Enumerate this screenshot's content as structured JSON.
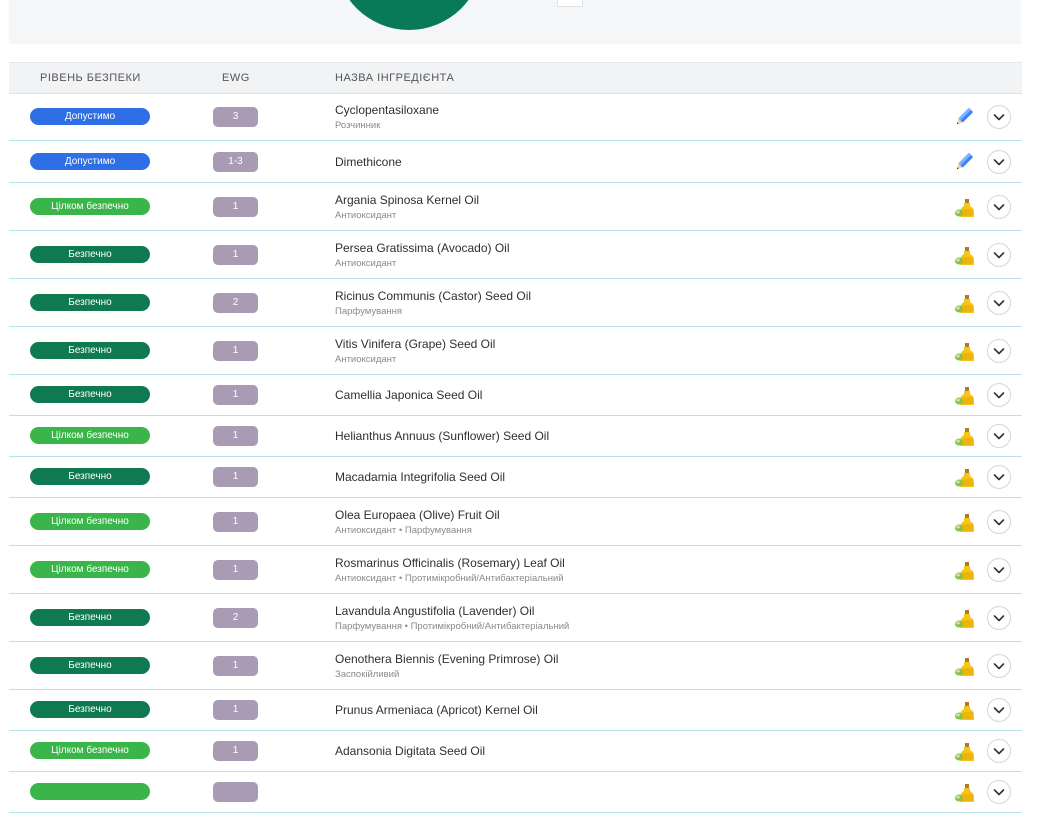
{
  "header": {
    "safety": "РІВЕНЬ БЕЗПЕКИ",
    "ewg": "EWG",
    "name": "НАЗВА ІНГРЕДІЄНТА"
  },
  "colors": {
    "acceptable": "#2f6fe6",
    "completely_safe": "#3ab54a",
    "safe": "#0f7a52",
    "ewg": "#a89bb3"
  },
  "rows": [
    {
      "safety": "Допустимо",
      "level": "acceptable",
      "ewg": "3",
      "name": "Cyclopentasiloxane",
      "func": "Розчинник",
      "icon": "pencil-icon"
    },
    {
      "safety": "Допустимо",
      "level": "acceptable",
      "ewg": "1-3",
      "name": "Dimethicone",
      "func": "",
      "icon": "pencil-icon"
    },
    {
      "safety": "Цілком безпечно",
      "level": "completely_safe",
      "ewg": "1",
      "name": "Argania Spinosa Kernel Oil",
      "func": "Антиоксидант",
      "icon": "oil-bottle-icon"
    },
    {
      "safety": "Безпечно",
      "level": "safe",
      "ewg": "1",
      "name": "Persea Gratissima (Avocado) Oil",
      "func": "Антиоксидант",
      "icon": "oil-bottle-icon"
    },
    {
      "safety": "Безпечно",
      "level": "safe",
      "ewg": "2",
      "name": "Ricinus Communis (Castor) Seed Oil",
      "func": "Парфумування",
      "icon": "oil-bottle-icon"
    },
    {
      "safety": "Безпечно",
      "level": "safe",
      "ewg": "1",
      "name": "Vitis Vinifera (Grape) Seed Oil",
      "func": "Антиоксидант",
      "icon": "oil-bottle-icon"
    },
    {
      "safety": "Безпечно",
      "level": "safe",
      "ewg": "1",
      "name": "Camellia Japonica Seed Oil",
      "func": "",
      "icon": "oil-bottle-icon"
    },
    {
      "safety": "Цілком безпечно",
      "level": "completely_safe",
      "ewg": "1",
      "name": "Helianthus Annuus (Sunflower) Seed Oil",
      "func": "",
      "icon": "oil-bottle-icon"
    },
    {
      "safety": "Безпечно",
      "level": "safe",
      "ewg": "1",
      "name": "Macadamia Integrifolia Seed Oil",
      "func": "",
      "icon": "oil-bottle-icon"
    },
    {
      "safety": "Цілком безпечно",
      "level": "completely_safe",
      "ewg": "1",
      "name": "Olea Europaea (Olive) Fruit Oil",
      "func": "Антиоксидант • Парфумування",
      "icon": "oil-bottle-icon"
    },
    {
      "safety": "Цілком безпечно",
      "level": "completely_safe",
      "ewg": "1",
      "name": "Rosmarinus Officinalis (Rosemary) Leaf Oil",
      "func": "Антиоксидант • Протимікробний/Антибактеріальний",
      "icon": "oil-bottle-icon"
    },
    {
      "safety": "Безпечно",
      "level": "safe",
      "ewg": "2",
      "name": "Lavandula Angustifolia (Lavender) Oil",
      "func": "Парфумування • Протимікробний/Антибактеріальний",
      "icon": "oil-bottle-icon"
    },
    {
      "safety": "Безпечно",
      "level": "safe",
      "ewg": "1",
      "name": "Oenothera Biennis (Evening Primrose) Oil",
      "func": "Заспокійливий",
      "icon": "oil-bottle-icon"
    },
    {
      "safety": "Безпечно",
      "level": "safe",
      "ewg": "1",
      "name": "Prunus Armeniaca (Apricot) Kernel Oil",
      "func": "",
      "icon": "oil-bottle-icon"
    },
    {
      "safety": "Цілком безпечно",
      "level": "completely_safe",
      "ewg": "1",
      "name": "Adansonia Digitata Seed Oil",
      "func": "",
      "icon": "oil-bottle-icon"
    },
    {
      "safety": "",
      "level": "completely_safe",
      "ewg": "",
      "name": "",
      "func": "",
      "icon": "oil-bottle-icon"
    }
  ]
}
